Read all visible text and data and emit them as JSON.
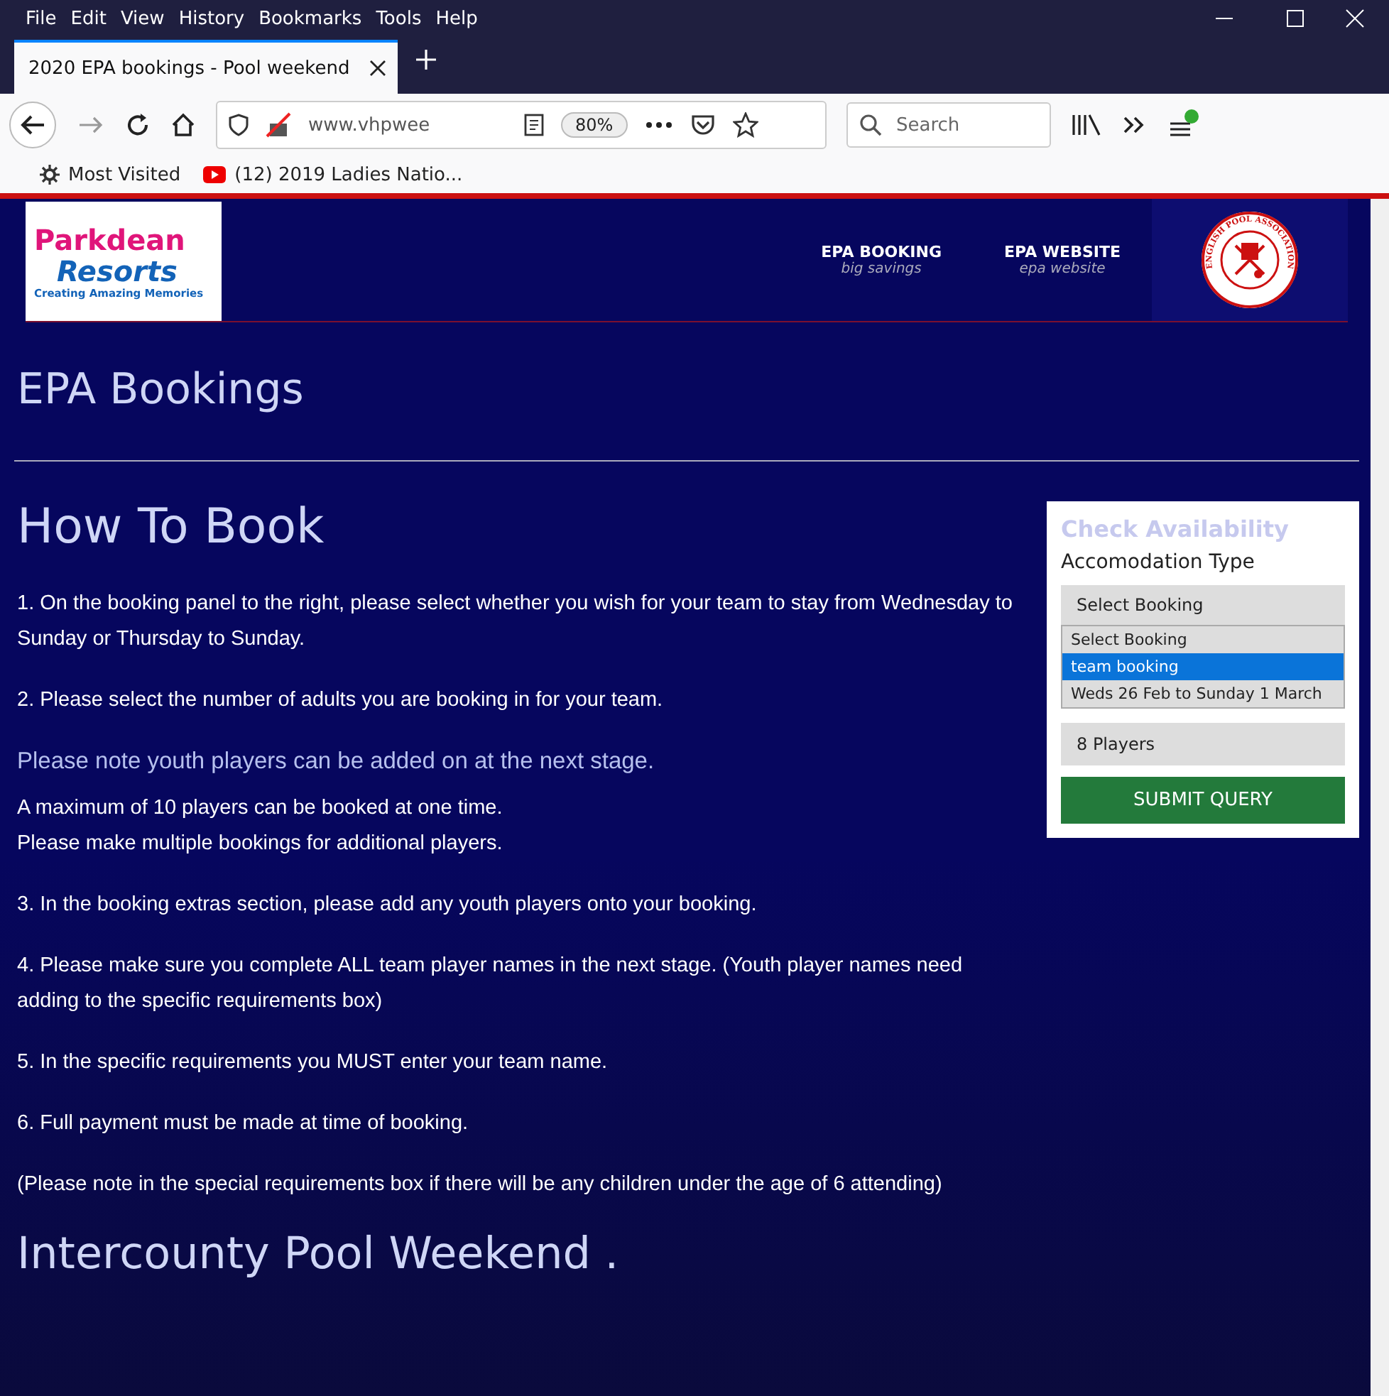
{
  "menu_bar": {
    "items": [
      "File",
      "Edit",
      "View",
      "History",
      "Bookmarks",
      "Tools",
      "Help"
    ]
  },
  "tabs": [
    {
      "title": "2020 EPA bookings - Pool weekend",
      "selected": true
    }
  ],
  "toolbar": {
    "url": "www.vhpwee",
    "zoom": "80%",
    "search_placeholder": "Search"
  },
  "bookmarks": [
    {
      "kind": "gear",
      "label": "Most Visited"
    },
    {
      "kind": "video",
      "label": "(12) 2019 Ladies Natio..."
    }
  ],
  "site_header": {
    "logo": {
      "line1": "Parkdean",
      "line2": "Resorts",
      "tagline": "Creating Amazing Memories"
    },
    "nav": [
      {
        "title": "EPA BOOKING",
        "subtitle": "big savings"
      },
      {
        "title": "EPA WEBSITE",
        "subtitle": "epa website"
      }
    ],
    "emblem_text": "ENGLISH POOL ASSOCIATION"
  },
  "page_title": "EPA Bookings",
  "section_title": "How To Book",
  "paragraphs": [
    {
      "kind": "step",
      "text": "1. On the booking panel to the right, please select whether you wish for your team to stay from Wednesday to Sunday or Thursday to Sunday."
    },
    {
      "kind": "step",
      "text": "2. Please select the number of adults you are booking in for your team."
    },
    {
      "kind": "note",
      "text": "Please note youth players can be added on at the next stage."
    },
    {
      "kind": "line",
      "text": "A maximum of 10 players can be booked at one time."
    },
    {
      "kind": "step",
      "text": "Please make multiple bookings for additional players."
    },
    {
      "kind": "step",
      "text": "3. In the booking extras section, please add any youth players onto your booking."
    },
    {
      "kind": "step",
      "text": "4. Please make sure you complete ALL team player names in the next stage. (Youth player names need adding to the specific requirements box)"
    },
    {
      "kind": "step",
      "text": "5. In the specific requirements you MUST enter your team name."
    },
    {
      "kind": "step",
      "text": "6. Full payment must be made at time of booking."
    },
    {
      "kind": "step",
      "text": "(Please note in the special requirements box if there will be any children under the age of 6 attending)"
    }
  ],
  "footer_title": "Intercounty Pool Weekend .",
  "booking_panel": {
    "title": "Check Availability",
    "label": "Accomodation Type",
    "select_value": "Select Booking",
    "options": [
      {
        "text": "Select Booking",
        "selected": false
      },
      {
        "text": "team booking",
        "selected": true
      },
      {
        "text": "Weds 26 Feb to Sunday 1 March",
        "selected": false
      }
    ],
    "players": "8 Players",
    "submit": "SUBMIT QUERY"
  }
}
